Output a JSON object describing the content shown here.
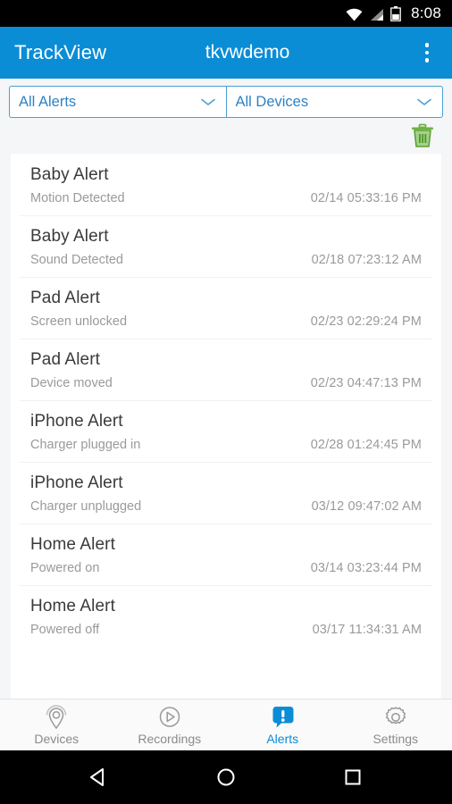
{
  "status_bar": {
    "time": "8:08",
    "icons": [
      "wifi-icon",
      "cell-signal-icon",
      "battery-icon"
    ]
  },
  "app_bar": {
    "title": "TrackView",
    "account": "tkvwdemo",
    "overflow_label": "overflow-menu"
  },
  "filters": {
    "alert_type": {
      "value": "All Alerts"
    },
    "device": {
      "value": "All Devices"
    },
    "delete_label": "delete-all"
  },
  "alerts": [
    {
      "title": "Baby Alert",
      "description": "Motion Detected",
      "timestamp": "02/14 05:33:16 PM"
    },
    {
      "title": "Baby Alert",
      "description": "Sound Detected",
      "timestamp": "02/18 07:23:12 AM"
    },
    {
      "title": "Pad Alert",
      "description": "Screen unlocked",
      "timestamp": "02/23 02:29:24 PM"
    },
    {
      "title": "Pad Alert",
      "description": "Device moved",
      "timestamp": "02/23 04:47:13 PM"
    },
    {
      "title": "iPhone Alert",
      "description": "Charger plugged in",
      "timestamp": "02/28 01:24:45 PM"
    },
    {
      "title": "iPhone Alert",
      "description": "Charger unplugged",
      "timestamp": "03/12 09:47:02 AM"
    },
    {
      "title": "Home Alert",
      "description": "Powered on",
      "timestamp": "03/14 03:23:44 PM"
    },
    {
      "title": "Home Alert",
      "description": "Powered off",
      "timestamp": "03/17 11:34:31 AM"
    }
  ],
  "tabs": [
    {
      "label": "Devices",
      "icon": "location-pin-icon",
      "active": false
    },
    {
      "label": "Recordings",
      "icon": "play-circle-icon",
      "active": false
    },
    {
      "label": "Alerts",
      "icon": "alert-bubble-icon",
      "active": true
    },
    {
      "label": "Settings",
      "icon": "gear-icon",
      "active": false
    }
  ],
  "system_nav": {
    "back": "back-button",
    "home": "home-button",
    "recents": "recents-button"
  },
  "colors": {
    "accent": "#0b8dd6",
    "page_bg": "#f4f6f8",
    "delete_green": "#6cb33f",
    "title_text": "#3a3a3a",
    "muted_text": "#9a9a9a"
  }
}
